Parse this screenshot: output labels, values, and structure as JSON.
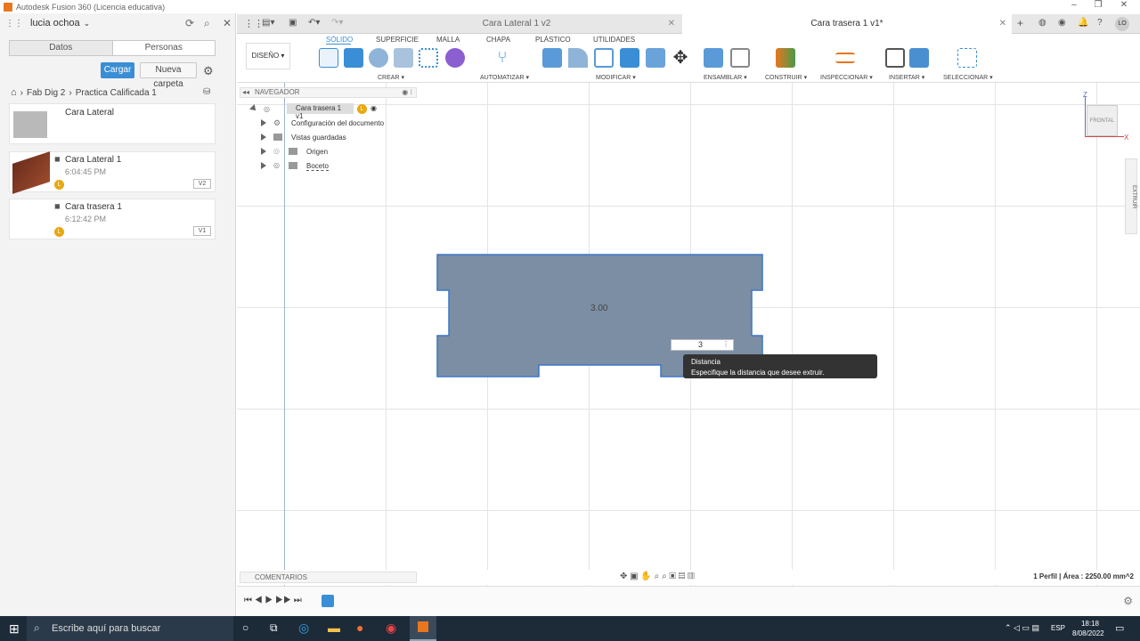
{
  "window": {
    "title": "Autodesk Fusion 360 (Licencia educativa)"
  },
  "left_panel": {
    "user": "lucia ochoa",
    "tabs": [
      "Datos",
      "Personas"
    ],
    "upload_label": "Cargar",
    "new_folder_label": "Nueva carpeta",
    "breadcrumb": [
      "Fab Dig 2",
      "Practica Calificada 1"
    ],
    "items": [
      {
        "name": "Cara Lateral",
        "time": "",
        "version": ""
      },
      {
        "name": "Cara Lateral 1",
        "time": "6:04:45 PM",
        "version": "V2"
      },
      {
        "name": "Cara trasera 1",
        "time": "6:12:42 PM",
        "version": "V1"
      }
    ]
  },
  "tabs": [
    {
      "label": "Cara Lateral 1 v2"
    },
    {
      "label": "Cara trasera 1 v1*"
    }
  ],
  "toolbar": {
    "workspace": "DISEÑO",
    "tabs": [
      "SÓLIDO",
      "SUPERFICIE",
      "MALLA",
      "CHAPA",
      "PLÁSTICO",
      "UTILIDADES"
    ],
    "groups": [
      "CREAR",
      "AUTOMATIZAR",
      "MODIFICAR",
      "ENSAMBLAR",
      "CONSTRUIR",
      "INSPECCIONAR",
      "INSERTAR",
      "SELECCIONAR"
    ]
  },
  "browser": {
    "title": "NAVEGADOR",
    "root": "Cara trasera 1 v1",
    "items": [
      "Configuración del documento",
      "Vistas guardadas",
      "Origen",
      "Boceto"
    ]
  },
  "viewcube": {
    "label": "FRONTAL",
    "z": "Z",
    "x": "X"
  },
  "extrude_tab": "EXTRUIR",
  "profile_label": "3.00",
  "dim_input_value": "3",
  "tooltip": {
    "title": "Distancia",
    "body": "Especifique la distancia que desee extruir."
  },
  "comments_label": "COMENTARIOS",
  "status": "1 Perfil | Área : 2250.00 mm^2",
  "taskbar": {
    "search": "Escribe aquí para buscar",
    "lang": "ESP",
    "time": "18:18",
    "date": "8/08/2022"
  },
  "colors": {
    "profile": "#7c8ea4",
    "accent": "#3a8ed5"
  }
}
